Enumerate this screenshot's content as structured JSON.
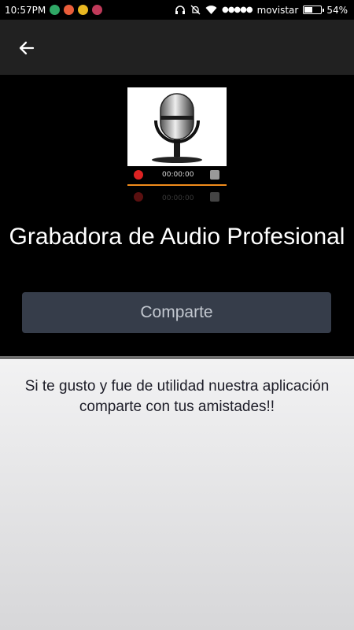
{
  "status_bar": {
    "time": "10:57PM",
    "carrier": "movistar",
    "signal_dots": "●●●●●",
    "battery_percent": "54%",
    "battery_level": 0.54,
    "notification_icons": [
      "download-notification-icon",
      "app-notification-icon",
      "coin-notification-icon",
      "camera-notification-icon"
    ]
  },
  "app_bar": {
    "back_icon": "arrow-left-icon"
  },
  "hero": {
    "image_timer_label": "00:00:00",
    "title": "Grabadora de Audio Profesional",
    "share_button_label": "Comparte"
  },
  "content": {
    "message": "Si te gusto y fue de utilidad nuestra aplicación comparte con tus amistades!!"
  },
  "colors": {
    "app_bar": "#212121",
    "share_button": "#363d4a",
    "content_bg": "#f2f2f3"
  }
}
